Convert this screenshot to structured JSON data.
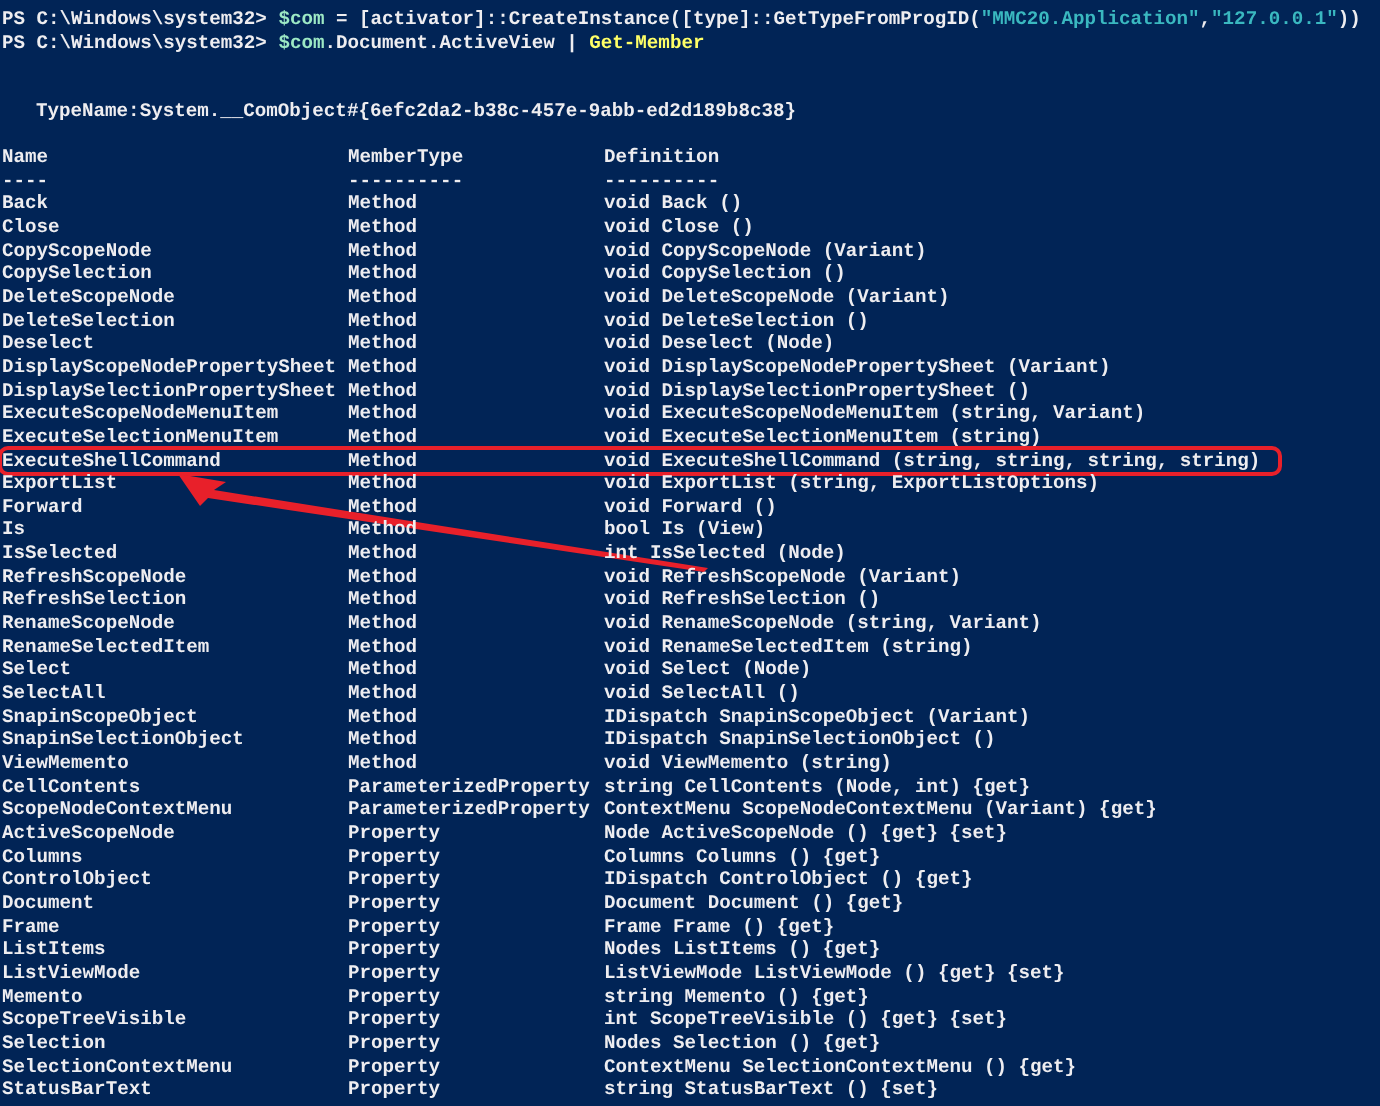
{
  "prompt_lines": [
    {
      "prompt": "PS C:\\Windows\\system32>",
      "tokens": [
        {
          "kind": "variable",
          "text": "$com"
        },
        {
          "kind": "plain",
          "text": " = [activator]::CreateInstance([type]::GetTypeFromProgID("
        },
        {
          "kind": "string",
          "text": "\"MMC20.Application\""
        },
        {
          "kind": "plain",
          "text": ","
        },
        {
          "kind": "string",
          "text": "\"127.0.0.1\""
        },
        {
          "kind": "plain",
          "text": "))"
        }
      ]
    },
    {
      "prompt": "PS C:\\Windows\\system32>",
      "tokens": [
        {
          "kind": "variable",
          "text": "$com"
        },
        {
          "kind": "plain",
          "text": ".Document.ActiveView | "
        },
        {
          "kind": "cmdlet",
          "text": "Get-Member"
        }
      ]
    }
  ],
  "type_name": "TypeName:System.__ComObject#{6efc2da2-b38c-457e-9abb-ed2d189b8c38}",
  "columns": [
    {
      "label": "Name",
      "rule": "----"
    },
    {
      "label": "MemberType",
      "rule": "----------"
    },
    {
      "label": "Definition",
      "rule": "----------"
    }
  ],
  "rows": [
    {
      "name": "Back",
      "member_type": "Method",
      "definition": "void Back ()",
      "highlighted": false
    },
    {
      "name": "Close",
      "member_type": "Method",
      "definition": "void Close ()",
      "highlighted": false
    },
    {
      "name": "CopyScopeNode",
      "member_type": "Method",
      "definition": "void CopyScopeNode (Variant)",
      "highlighted": false
    },
    {
      "name": "CopySelection",
      "member_type": "Method",
      "definition": "void CopySelection ()",
      "highlighted": false
    },
    {
      "name": "DeleteScopeNode",
      "member_type": "Method",
      "definition": "void DeleteScopeNode (Variant)",
      "highlighted": false
    },
    {
      "name": "DeleteSelection",
      "member_type": "Method",
      "definition": "void DeleteSelection ()",
      "highlighted": false
    },
    {
      "name": "Deselect",
      "member_type": "Method",
      "definition": "void Deselect (Node)",
      "highlighted": false
    },
    {
      "name": "DisplayScopeNodePropertySheet",
      "member_type": "Method",
      "definition": "void DisplayScopeNodePropertySheet (Variant)",
      "highlighted": false
    },
    {
      "name": "DisplaySelectionPropertySheet",
      "member_type": "Method",
      "definition": "void DisplaySelectionPropertySheet ()",
      "highlighted": false
    },
    {
      "name": "ExecuteScopeNodeMenuItem",
      "member_type": "Method",
      "definition": "void ExecuteScopeNodeMenuItem (string, Variant)",
      "highlighted": false
    },
    {
      "name": "ExecuteSelectionMenuItem",
      "member_type": "Method",
      "definition": "void ExecuteSelectionMenuItem (string)",
      "highlighted": false
    },
    {
      "name": "ExecuteShellCommand",
      "member_type": "Method",
      "definition": "void ExecuteShellCommand (string, string, string, string)",
      "highlighted": true
    },
    {
      "name": "ExportList",
      "member_type": "Method",
      "definition": "void ExportList (string, ExportListOptions)",
      "highlighted": false
    },
    {
      "name": "Forward",
      "member_type": "Method",
      "definition": "void Forward ()",
      "highlighted": false
    },
    {
      "name": "Is",
      "member_type": "Method",
      "definition": "bool Is (View)",
      "highlighted": false
    },
    {
      "name": "IsSelected",
      "member_type": "Method",
      "definition": "int IsSelected (Node)",
      "highlighted": false
    },
    {
      "name": "RefreshScopeNode",
      "member_type": "Method",
      "definition": "void RefreshScopeNode (Variant)",
      "highlighted": false
    },
    {
      "name": "RefreshSelection",
      "member_type": "Method",
      "definition": "void RefreshSelection ()",
      "highlighted": false
    },
    {
      "name": "RenameScopeNode",
      "member_type": "Method",
      "definition": "void RenameScopeNode (string, Variant)",
      "highlighted": false
    },
    {
      "name": "RenameSelectedItem",
      "member_type": "Method",
      "definition": "void RenameSelectedItem (string)",
      "highlighted": false
    },
    {
      "name": "Select",
      "member_type": "Method",
      "definition": "void Select (Node)",
      "highlighted": false
    },
    {
      "name": "SelectAll",
      "member_type": "Method",
      "definition": "void SelectAll ()",
      "highlighted": false
    },
    {
      "name": "SnapinScopeObject",
      "member_type": "Method",
      "definition": "IDispatch SnapinScopeObject (Variant)",
      "highlighted": false
    },
    {
      "name": "SnapinSelectionObject",
      "member_type": "Method",
      "definition": "IDispatch SnapinSelectionObject ()",
      "highlighted": false
    },
    {
      "name": "ViewMemento",
      "member_type": "Method",
      "definition": "void ViewMemento (string)",
      "highlighted": false
    },
    {
      "name": "CellContents",
      "member_type": "ParameterizedProperty",
      "definition": "string CellContents (Node, int) {get}",
      "highlighted": false
    },
    {
      "name": "ScopeNodeContextMenu",
      "member_type": "ParameterizedProperty",
      "definition": "ContextMenu ScopeNodeContextMenu (Variant) {get}",
      "highlighted": false
    },
    {
      "name": "ActiveScopeNode",
      "member_type": "Property",
      "definition": "Node ActiveScopeNode () {get} {set}",
      "highlighted": false
    },
    {
      "name": "Columns",
      "member_type": "Property",
      "definition": "Columns Columns () {get}",
      "highlighted": false
    },
    {
      "name": "ControlObject",
      "member_type": "Property",
      "definition": "IDispatch ControlObject () {get}",
      "highlighted": false
    },
    {
      "name": "Document",
      "member_type": "Property",
      "definition": "Document Document () {get}",
      "highlighted": false
    },
    {
      "name": "Frame",
      "member_type": "Property",
      "definition": "Frame Frame () {get}",
      "highlighted": false
    },
    {
      "name": "ListItems",
      "member_type": "Property",
      "definition": "Nodes ListItems () {get}",
      "highlighted": false
    },
    {
      "name": "ListViewMode",
      "member_type": "Property",
      "definition": "ListViewMode ListViewMode () {get} {set}",
      "highlighted": false
    },
    {
      "name": "Memento",
      "member_type": "Property",
      "definition": "string Memento () {get}",
      "highlighted": false
    },
    {
      "name": "ScopeTreeVisible",
      "member_type": "Property",
      "definition": "int ScopeTreeVisible () {get} {set}",
      "highlighted": false
    },
    {
      "name": "Selection",
      "member_type": "Property",
      "definition": "Nodes Selection () {get}",
      "highlighted": false
    },
    {
      "name": "SelectionContextMenu",
      "member_type": "Property",
      "definition": "ContextMenu SelectionContextMenu () {get}",
      "highlighted": false
    },
    {
      "name": "StatusBarText",
      "member_type": "Property",
      "definition": "string StatusBarText () {set}",
      "highlighted": false
    }
  ]
}
